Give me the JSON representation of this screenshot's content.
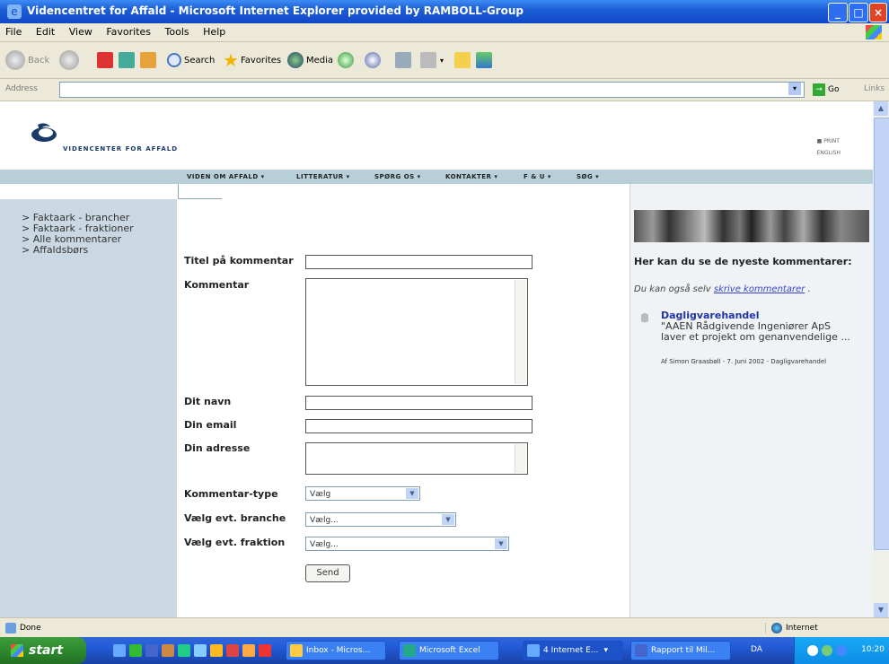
{
  "window": {
    "title": "Videncentret for Affald - Microsoft Internet Explorer provided by RAMBOLL-Group"
  },
  "menu": [
    "File",
    "Edit",
    "View",
    "Favorites",
    "Tools",
    "Help"
  ],
  "toolbar": {
    "back": "Back",
    "search": "Search",
    "favorites": "Favorites",
    "media": "Media"
  },
  "address": {
    "label": "Address",
    "value": "",
    "go": "Go",
    "links": "Links"
  },
  "site": {
    "logo_text": "VIDENCENTER FOR AFFALD",
    "top_links": [
      "PRINT",
      "ENGLISH"
    ],
    "nav": [
      "VIDEN OM AFFALD ▾",
      "LITTERATUR ▾",
      "SPØRG OS ▾",
      "KONTAKTER ▾",
      "F & U ▾",
      "SØG ▾"
    ]
  },
  "sidebar": {
    "items": [
      "> Faktaark - brancher",
      "> Faktaark - fraktioner",
      "> Alle kommentarer",
      "> Affaldsbørs"
    ]
  },
  "form": {
    "title_label": "Titel på kommentar",
    "comment_label": "Kommentar",
    "name_label": "Dit navn",
    "email_label": "Din email",
    "address_label": "Din adresse",
    "type_label": "Kommentar-type",
    "type_value": "Vælg",
    "branch_label": "Vælg evt. branche",
    "branch_value": "Vælg...",
    "fraction_label": "Vælg evt. fraktion",
    "fraction_value": "Vælg...",
    "send_label": "Send"
  },
  "right": {
    "heading": "Her kan du se de nyeste kommentarer:",
    "info_prefix": "Du kan også selv",
    "info_link": "skrive kommentarer",
    "info_suffix": ".",
    "comment_title": "Dagligvarehandel",
    "comment_text": "\"AAEN Rådgivende Ingeniører ApS laver et projekt om genanvendelige ...",
    "comment_meta": "Af Simon Graasbøll - 7. Juni 2002 - Dagligvarehandel"
  },
  "status": {
    "left": "Done",
    "zone": "Internet"
  },
  "taskbar": {
    "start": "start",
    "tasks": [
      "Inbox - Micros...",
      "Microsoft Excel",
      "4 Internet E...",
      "Rapport til Mil..."
    ],
    "lang": "DA",
    "clock": "10:20"
  }
}
